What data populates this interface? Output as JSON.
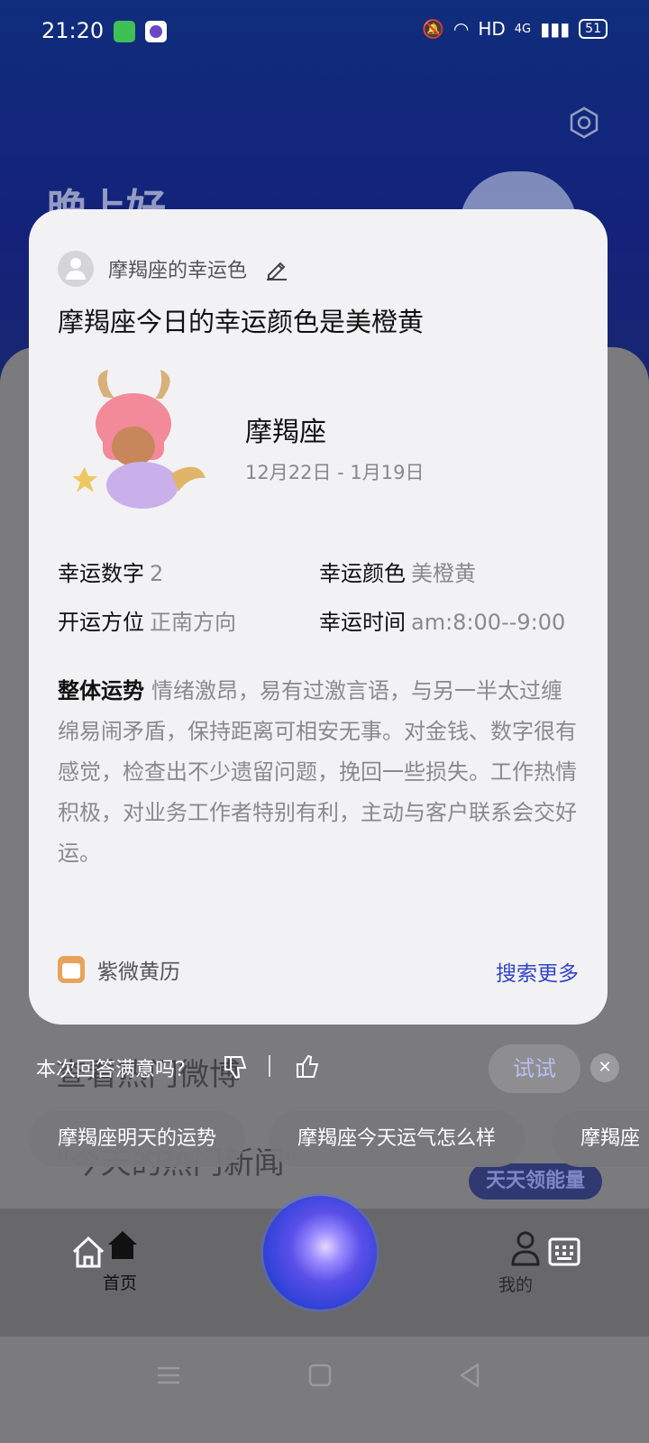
{
  "status_bar": {
    "time": "21:20",
    "network": "HD",
    "signal_type": "4G",
    "battery": "51"
  },
  "background": {
    "greeting": "晚上好",
    "try_button": "试试",
    "energy_badge": "天天领能量",
    "hint_1": "查看热门微博",
    "hint_2": "\"今天的热门新闻\""
  },
  "card": {
    "source_label": "摩羯座的幸运色",
    "headline": "摩羯座今日的幸运颜色是美橙黄",
    "sign_name": "摩羯座",
    "date_range": "12月22日 - 1月19日",
    "info": [
      {
        "label": "幸运数字",
        "value": "2"
      },
      {
        "label": "幸运颜色",
        "value": "美橙黄"
      },
      {
        "label": "开运方位",
        "value": "正南方向"
      },
      {
        "label": "幸运时间",
        "value": "am:8:00--9:00"
      }
    ],
    "overall_label": "整体运势",
    "overall_text": "情绪激昂，易有过激言语，与另一半太过缠绵易闹矛盾，保持距离可相安无事。对金钱、数字很有感觉，检查出不少遗留问题，挽回一些损失。工作热情积极，对业务工作者特别有利，主动与客户联系会交好运。",
    "provider": "紫微黄历",
    "more_link": "搜索更多"
  },
  "feedback": {
    "question": "本次回答满意吗？"
  },
  "suggestions": [
    "摩羯座明天的运势",
    "摩羯座今天运气怎么样",
    "摩羯座"
  ],
  "bottom_nav": {
    "home_label": "首页",
    "mine_label": "我的"
  },
  "colors": {
    "accent": "#3344c8",
    "card_bg": "#f2f2f5"
  }
}
